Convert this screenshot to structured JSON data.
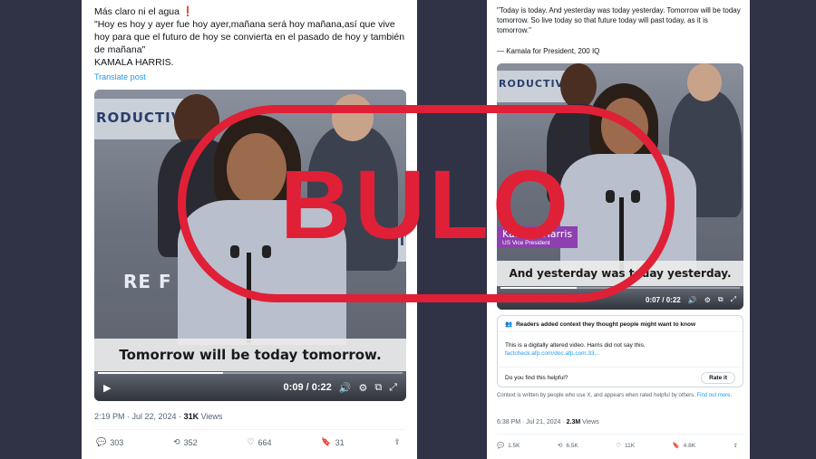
{
  "left_tweet": {
    "text": "Más claro ni el agua ❗\n\"Hoy es hoy y ayer fue hoy ayer,mañana será hoy mañana,así que vive hoy para que el futuro de hoy se convierta en el pasado de hoy y también de mañana\"\nKAMALA HARRIS.",
    "translate": "Translate post",
    "video": {
      "caption": "Tomorrow will be today tomorrow.",
      "time": "0:09 / 0:22",
      "progress": 0.41,
      "banner_1": "RODUCTIVE",
      "banner_2": "DUCTIV",
      "banner_3": "RE F"
    },
    "meta": {
      "time": "2:19 PM · Jul 22, 2024 · ",
      "views_count": "31K",
      "views_label": " Views"
    },
    "actions": {
      "replies": "303",
      "reposts": "352",
      "likes": "664",
      "bookmarks": "31"
    }
  },
  "right_tweet": {
    "quote": "\"Today is today. And yesterday was today yesterday. Tomorrow will be today tomorrow. So live today so that future today will past today, as it is tomorrow.\"",
    "attribution": "— Kamala for President, 200 IQ",
    "video": {
      "caption": "And yesterday was today yesterday.",
      "time": "0:07 / 0:22",
      "progress": 0.32,
      "banner": "RODUCTIVE",
      "name_tag": {
        "name": "Kamala Harris",
        "role": "US Vice President"
      }
    },
    "community_note": {
      "header": "Readers added context they thought people might want to know",
      "body": "This is a digitally altered video. Harris did not say this.",
      "link": "factcheck.afp.com/doc.afp.com.33...",
      "question": "Do you find this helpful?",
      "rate_button": "Rate it"
    },
    "context_note": "Context is written by people who use X, and appears when rated helpful by others. ",
    "find_out_more": "Find out more.",
    "meta": {
      "time": "6:38 PM · Jul 21, 2024 · ",
      "views_count": "2.3M",
      "views_label": " Views"
    },
    "actions": {
      "replies": "1.5K",
      "reposts": "6.5K",
      "likes": "11K",
      "bookmarks": "4.8K"
    }
  },
  "stamp": {
    "text": "BULO",
    "color": "#e02036"
  },
  "icons": {
    "play": "▶",
    "volume": "🔊",
    "settings": "⚙",
    "fullscreen": "⤢",
    "pip": "⧉",
    "reply": "💬",
    "repost": "⟲",
    "like": "♡",
    "bookmark": "🔖",
    "share": "⇪",
    "community": "👥"
  }
}
